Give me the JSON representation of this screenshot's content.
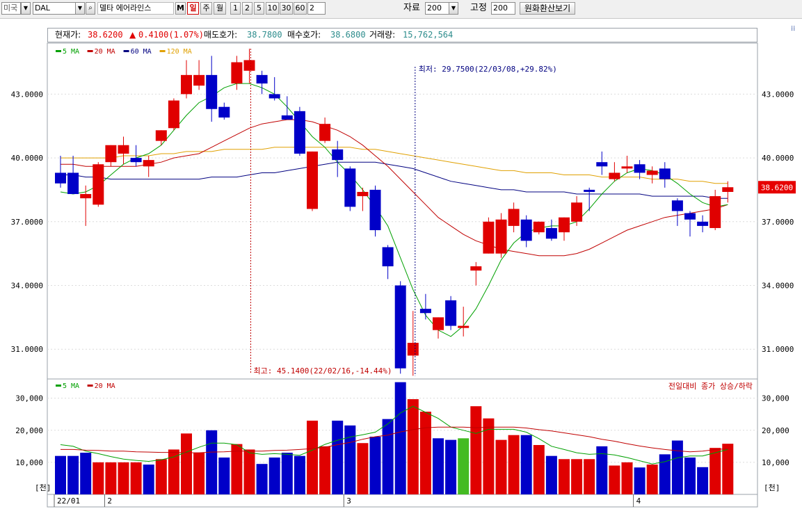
{
  "toolbar": {
    "market": "미국",
    "symbol": "DAL",
    "name": "델타 에어라인스",
    "m_label": "M",
    "periods": [
      "일",
      "주",
      "월"
    ],
    "intervals": [
      "1",
      "2",
      "5",
      "10",
      "30",
      "60"
    ],
    "interval_value": "2",
    "data_label": "자료",
    "data_count": "200",
    "fixed_label": "고정",
    "fixed_count": "200",
    "fx_button": "원화환산보기"
  },
  "header": {
    "price_label": "현재가:",
    "price": "38.6200",
    "change": "0.4100(1.07%)",
    "ask_label": "매도호가:",
    "ask": "38.7800",
    "bid_label": "매수호가:",
    "bid": "38.6800",
    "volume_label": "거래량:",
    "volume": "15,762,564"
  },
  "colors": {
    "up": "#e00000",
    "down": "#0000c8",
    "ma5": "#00a000",
    "ma20": "#c00000",
    "ma60": "#000080",
    "ma120": "#e0a000",
    "volume_neutral": "#44bb22"
  },
  "chart_data": [
    {
      "type": "candlestick",
      "legend": [
        "5 MA",
        "20 MA",
        "60 MA",
        "120 MA"
      ],
      "ylim": [
        29.6,
        45.4
      ],
      "yticks": [
        31,
        34,
        37,
        40,
        43
      ],
      "ytick_labels": [
        "31.0000",
        "34.0000",
        "37.0000",
        "40.0000",
        "43.0000"
      ],
      "last_price_label": "38.6200",
      "annotation_low": "최저: 29.7500(22/03/08,+29.82%)",
      "annotation_high": "최고: 45.1400(22/02/16,-14.44%)",
      "ohlc": [
        [
          39.3,
          40.1,
          38.6,
          38.8
        ],
        [
          39.3,
          40.1,
          38.4,
          38.3
        ],
        [
          38.1,
          38.7,
          36.8,
          38.3
        ],
        [
          37.8,
          39.8,
          37.7,
          39.7
        ],
        [
          39.8,
          40.6,
          39.6,
          40.6
        ],
        [
          40.2,
          41.0,
          39.7,
          40.6
        ],
        [
          40.0,
          40.6,
          39.6,
          39.8
        ],
        [
          39.6,
          40.1,
          39.1,
          39.9
        ],
        [
          40.8,
          41.3,
          40.6,
          41.3
        ],
        [
          41.4,
          42.8,
          41.3,
          42.7
        ],
        [
          43.0,
          44.6,
          42.8,
          43.9
        ],
        [
          43.4,
          44.6,
          43.2,
          43.9
        ],
        [
          43.9,
          44.8,
          41.7,
          42.3
        ],
        [
          42.4,
          42.6,
          41.8,
          41.9
        ],
        [
          43.5,
          44.8,
          43.2,
          44.5
        ],
        [
          44.1,
          45.14,
          43.5,
          44.6
        ],
        [
          43.9,
          44.1,
          43.0,
          43.5
        ],
        [
          43.0,
          43.8,
          42.7,
          42.8
        ],
        [
          42.0,
          42.9,
          41.8,
          41.8
        ],
        [
          42.2,
          42.4,
          40.1,
          40.2
        ],
        [
          37.6,
          40.3,
          37.5,
          40.3
        ],
        [
          40.8,
          41.9,
          40.7,
          41.6
        ],
        [
          40.4,
          40.8,
          39.1,
          39.9
        ],
        [
          39.5,
          39.6,
          37.5,
          37.7
        ],
        [
          38.2,
          38.6,
          37.5,
          38.4
        ],
        [
          38.5,
          38.7,
          36.3,
          36.6
        ],
        [
          35.8,
          35.9,
          34.3,
          34.9
        ],
        [
          34.0,
          34.2,
          29.85,
          30.1
        ],
        [
          30.7,
          32.8,
          29.75,
          31.3
        ],
        [
          32.9,
          33.6,
          32.4,
          32.7
        ],
        [
          31.9,
          32.5,
          31.5,
          32.5
        ],
        [
          33.3,
          33.5,
          31.9,
          32.1
        ],
        [
          32.0,
          33.0,
          31.6,
          32.1
        ],
        [
          34.7,
          35.1,
          34.0,
          34.9
        ],
        [
          35.5,
          37.2,
          35.5,
          37.0
        ],
        [
          35.5,
          37.4,
          35.3,
          37.1
        ],
        [
          36.8,
          37.9,
          36.5,
          37.6
        ],
        [
          37.1,
          37.3,
          35.8,
          36.1
        ],
        [
          36.5,
          37.0,
          36.4,
          37.0
        ],
        [
          36.7,
          37.1,
          36.1,
          36.2
        ],
        [
          36.5,
          37.2,
          36.1,
          37.2
        ],
        [
          37.0,
          38.2,
          36.8,
          37.9
        ],
        [
          38.5,
          38.6,
          37.5,
          38.4
        ],
        [
          39.8,
          40.3,
          39.2,
          39.6
        ],
        [
          39.0,
          39.8,
          38.9,
          39.3
        ],
        [
          39.5,
          40.1,
          39.3,
          39.6
        ],
        [
          39.7,
          39.9,
          39.0,
          39.3
        ],
        [
          39.2,
          39.6,
          38.8,
          39.4
        ],
        [
          39.5,
          39.8,
          38.6,
          39.0
        ],
        [
          38.0,
          38.1,
          36.8,
          37.5
        ],
        [
          37.4,
          37.5,
          36.3,
          37.1
        ],
        [
          37.0,
          37.3,
          36.5,
          36.8
        ],
        [
          36.7,
          38.5,
          36.6,
          38.2
        ],
        [
          38.4,
          38.9,
          37.9,
          38.62
        ]
      ],
      "ma5": [
        38.4,
        38.3,
        38.4,
        38.7,
        39.2,
        39.7,
        40.0,
        40.2,
        40.6,
        41.3,
        42.0,
        42.6,
        42.9,
        43.3,
        43.5,
        43.5,
        43.3,
        43.0,
        42.4,
        41.7,
        41.0,
        40.5,
        39.8,
        39.2,
        38.5,
        37.7,
        36.8,
        35.3,
        33.8,
        32.6,
        31.9,
        31.6,
        32.1,
        32.9,
        34.0,
        35.2,
        36.0,
        36.5,
        36.7,
        36.8,
        36.8,
        37.0,
        37.6,
        38.3,
        38.9,
        39.3,
        39.5,
        39.4,
        39.2,
        38.8,
        38.3,
        37.9,
        37.7,
        37.8
      ],
      "ma20": [
        39.7,
        39.7,
        39.6,
        39.6,
        39.6,
        39.6,
        39.6,
        39.7,
        39.8,
        40.0,
        40.1,
        40.2,
        40.5,
        40.8,
        41.1,
        41.4,
        41.6,
        41.7,
        41.8,
        41.8,
        41.7,
        41.5,
        41.3,
        41.0,
        40.6,
        40.1,
        39.6,
        39.0,
        38.4,
        37.8,
        37.2,
        36.8,
        36.4,
        36.1,
        35.9,
        35.7,
        35.6,
        35.5,
        35.4,
        35.4,
        35.4,
        35.5,
        35.7,
        36.0,
        36.3,
        36.6,
        36.8,
        37.0,
        37.2,
        37.3,
        37.4,
        37.5,
        37.6,
        37.8
      ],
      "ma60": [
        39.2,
        39.2,
        39.1,
        39.1,
        39.0,
        39.0,
        39.0,
        39.0,
        39.0,
        39.0,
        39.0,
        39.0,
        39.1,
        39.1,
        39.1,
        39.2,
        39.3,
        39.3,
        39.4,
        39.5,
        39.6,
        39.7,
        39.8,
        39.8,
        39.8,
        39.8,
        39.7,
        39.6,
        39.5,
        39.3,
        39.1,
        38.9,
        38.8,
        38.7,
        38.6,
        38.5,
        38.5,
        38.4,
        38.4,
        38.4,
        38.4,
        38.3,
        38.3,
        38.3,
        38.3,
        38.3,
        38.3,
        38.2,
        38.2,
        38.2,
        38.2,
        38.2,
        38.1,
        38.1
      ],
      "ma120": [
        40.0,
        40.0,
        40.0,
        40.0,
        40.0,
        40.1,
        40.1,
        40.1,
        40.2,
        40.2,
        40.3,
        40.3,
        40.3,
        40.4,
        40.4,
        40.4,
        40.4,
        40.5,
        40.5,
        40.5,
        40.5,
        40.5,
        40.5,
        40.5,
        40.4,
        40.4,
        40.3,
        40.2,
        40.1,
        40.0,
        39.9,
        39.8,
        39.7,
        39.6,
        39.5,
        39.4,
        39.4,
        39.3,
        39.3,
        39.3,
        39.2,
        39.2,
        39.2,
        39.1,
        39.1,
        39.1,
        39.1,
        39.0,
        39.0,
        39.0,
        38.9,
        38.9,
        38.8,
        38.8
      ]
    },
    {
      "type": "bar",
      "legend": [
        "5 MA",
        "20 MA"
      ],
      "note": "전일대비 종가 상승/하락",
      "ylim": [
        0,
        36000
      ],
      "yticks": [
        10000,
        20000,
        30000
      ],
      "ytick_labels": [
        "10,000",
        "20,000",
        "30,000"
      ],
      "unit_label": "[천]",
      "volume": [
        12000,
        12000,
        13000,
        10000,
        10000,
        10000,
        10000,
        9300,
        11000,
        14000,
        19000,
        13000,
        20000,
        11500,
        15700,
        14000,
        9500,
        11500,
        13000,
        12000,
        23000,
        15000,
        23000,
        21500,
        16000,
        18000,
        23500,
        35000,
        29700,
        25800,
        17500,
        17000,
        17500,
        27500,
        23700,
        17000,
        18500,
        18500,
        15400,
        12000,
        11000,
        11000,
        11000,
        15000,
        9000,
        10000,
        8400,
        9300,
        12500,
        16800,
        11500,
        8500,
        14500,
        15800
      ],
      "direction": [
        "down",
        "down",
        "down",
        "up",
        "up",
        "up",
        "up",
        "down",
        "up",
        "up",
        "up",
        "up",
        "down",
        "down",
        "up",
        "up",
        "down",
        "down",
        "down",
        "down",
        "up",
        "up",
        "down",
        "down",
        "up",
        "down",
        "down",
        "down",
        "up",
        "up",
        "down",
        "down",
        "neutral",
        "up",
        "up",
        "up",
        "up",
        "down",
        "up",
        "down",
        "up",
        "up",
        "up",
        "down",
        "up",
        "up",
        "down",
        "up",
        "down",
        "down",
        "down",
        "down",
        "up",
        "up"
      ],
      "ma5": [
        15500,
        15000,
        13500,
        12700,
        11800,
        11000,
        10600,
        10300,
        10800,
        11700,
        13200,
        14700,
        16000,
        16000,
        15500,
        13000,
        12500,
        12700,
        12500,
        12200,
        13800,
        15600,
        16900,
        17900,
        18600,
        19400,
        22000,
        25400,
        27500,
        25600,
        23700,
        21000,
        20000,
        19000,
        20300,
        20300,
        20300,
        19400,
        17400,
        15000,
        14000,
        13000,
        12500,
        12700,
        12300,
        11500,
        10500,
        9500,
        10200,
        11400,
        12000,
        12000,
        13000,
        14000
      ],
      "ma20": [
        14000,
        14000,
        13800,
        13700,
        13500,
        13500,
        13300,
        13200,
        13100,
        13100,
        13000,
        13000,
        13200,
        13300,
        13500,
        13500,
        13500,
        13700,
        13800,
        14000,
        14300,
        14700,
        15500,
        16200,
        17200,
        18000,
        18500,
        19500,
        20200,
        20800,
        21000,
        21000,
        21000,
        20800,
        21000,
        21000,
        21000,
        20700,
        20200,
        19800,
        19200,
        18600,
        18000,
        17200,
        16600,
        15800,
        15100,
        14500,
        14000,
        13600,
        13300,
        13500,
        14000,
        14200
      ],
      "x_labels": [
        {
          "i": 0,
          "t": "22/01"
        },
        {
          "i": 4,
          "t": "2"
        },
        {
          "i": 23,
          "t": "3"
        },
        {
          "i": 46,
          "t": "4"
        }
      ]
    }
  ]
}
